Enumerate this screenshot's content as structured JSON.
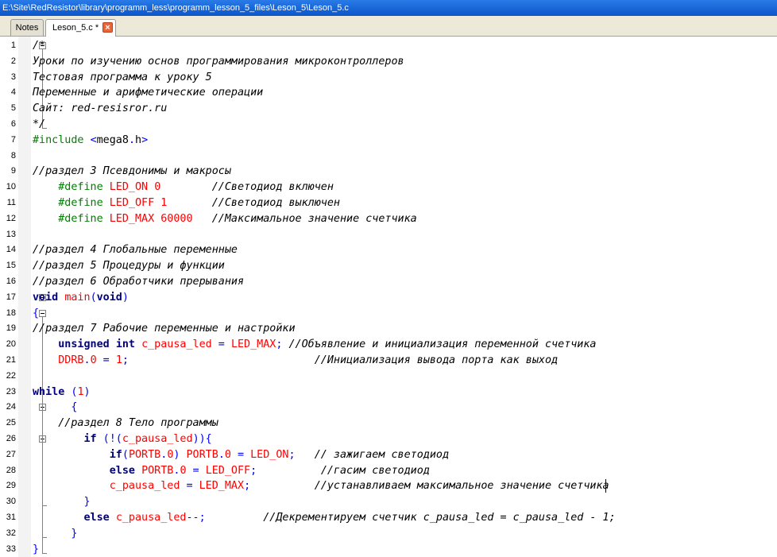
{
  "window": {
    "title": "E:\\Site\\RedResistor\\library\\programm_less\\programm_lesson_5_files\\Leson_5\\Leson_5.c"
  },
  "tabs": [
    {
      "label": "Notes",
      "active": false
    },
    {
      "label": "Leson_5.c *",
      "active": true,
      "close_icon": "close-icon"
    }
  ],
  "colors": {
    "comment": "#000000",
    "keyword": "#000080",
    "preprocessor": "#008000",
    "operator": "#0000ff",
    "identifier": "#000000",
    "red": "#ff0000",
    "title_bar": "#0b55c8"
  },
  "editor": {
    "line_numbers": [
      "1",
      "2",
      "3",
      "4",
      "5",
      "6",
      "7",
      "8",
      "9",
      "10",
      "11",
      "12",
      "13",
      "14",
      "15",
      "16",
      "17",
      "18",
      "19",
      "20",
      "21",
      "22",
      "23",
      "24",
      "25",
      "26",
      "27",
      "28",
      "29",
      "30",
      "31",
      "32",
      "33"
    ],
    "lines": [
      [
        {
          "t": "/*",
          "c": "comment",
          "s": "it"
        }
      ],
      [
        {
          "t": "Уроки по изучению основ программирования микроконтроллеров",
          "c": "comment",
          "s": "it"
        }
      ],
      [
        {
          "t": "Тестовая программа к уроку 5",
          "c": "comment",
          "s": "it"
        }
      ],
      [
        {
          "t": "Переменные и арифметические операции",
          "c": "comment",
          "s": "it"
        }
      ],
      [
        {
          "t": "Сайт: red-resisror.ru",
          "c": "comment",
          "s": "it"
        }
      ],
      [
        {
          "t": "*/",
          "c": "comment",
          "s": "it"
        }
      ],
      [
        {
          "t": "#include ",
          "c": "preprocessor"
        },
        {
          "t": "<",
          "c": "operator"
        },
        {
          "t": "mega8",
          "c": "identifier"
        },
        {
          "t": ".",
          "c": "operator"
        },
        {
          "t": "h",
          "c": "identifier"
        },
        {
          "t": ">",
          "c": "operator"
        }
      ],
      [],
      [
        {
          "t": "//раздел 3 Псевдонимы и макросы",
          "c": "comment",
          "s": "it"
        }
      ],
      [
        {
          "t": "    #define ",
          "c": "preprocessor"
        },
        {
          "t": "LED_ON 0        ",
          "c": "preprocessor_val"
        },
        {
          "t": "//Светодиод включен",
          "c": "comment",
          "s": "it"
        }
      ],
      [
        {
          "t": "    #define ",
          "c": "preprocessor"
        },
        {
          "t": "LED_OFF 1       ",
          "c": "preprocessor_val"
        },
        {
          "t": "//Светодиод выключен",
          "c": "comment",
          "s": "it"
        }
      ],
      [
        {
          "t": "    #define ",
          "c": "preprocessor"
        },
        {
          "t": "LED_MAX 60000   ",
          "c": "preprocessor_val"
        },
        {
          "t": "//Максимальное значение счетчика",
          "c": "comment",
          "s": "it"
        }
      ],
      [],
      [
        {
          "t": "//раздел 4 Глобальные переменные",
          "c": "comment",
          "s": "it"
        }
      ],
      [
        {
          "t": "//раздел 5 Процедуры и функции",
          "c": "comment",
          "s": "it"
        }
      ],
      [
        {
          "t": "//раздел 6 Обработчики прерывания",
          "c": "comment",
          "s": "it"
        }
      ],
      [
        {
          "t": "void",
          "c": "keyword",
          "s": "bd"
        },
        {
          "t": " ",
          "c": "identifier"
        },
        {
          "t": "main",
          "c": "red"
        },
        {
          "t": "(",
          "c": "operator"
        },
        {
          "t": "void",
          "c": "keyword",
          "s": "bd"
        },
        {
          "t": ")",
          "c": "operator"
        }
      ],
      [
        {
          "t": "{",
          "c": "operator"
        }
      ],
      [
        {
          "t": "//раздел 7 Рабочие переменные и настройки",
          "c": "comment",
          "s": "it"
        }
      ],
      [
        {
          "t": "    ",
          "c": "identifier"
        },
        {
          "t": "unsigned",
          "c": "keyword",
          "s": "bd"
        },
        {
          "t": " ",
          "c": "identifier"
        },
        {
          "t": "int",
          "c": "keyword",
          "s": "bd"
        },
        {
          "t": " ",
          "c": "identifier"
        },
        {
          "t": "c_pausa_led",
          "c": "red"
        },
        {
          "t": " = ",
          "c": "operator"
        },
        {
          "t": "LED_MAX",
          "c": "red"
        },
        {
          "t": "; ",
          "c": "operator"
        },
        {
          "t": "//Объявление и инициализация переменной счетчика",
          "c": "comment",
          "s": "it"
        }
      ],
      [
        {
          "t": "    ",
          "c": "identifier"
        },
        {
          "t": "DDRB",
          "c": "red"
        },
        {
          "t": ".",
          "c": "operator"
        },
        {
          "t": "0",
          "c": "red"
        },
        {
          "t": " = ",
          "c": "operator"
        },
        {
          "t": "1",
          "c": "red"
        },
        {
          "t": ";                             ",
          "c": "operator"
        },
        {
          "t": "//Инициализация вывода порта как выход",
          "c": "comment",
          "s": "it"
        }
      ],
      [],
      [
        {
          "t": "while",
          "c": "keyword",
          "s": "bd"
        },
        {
          "t": " ",
          "c": "identifier"
        },
        {
          "t": "(",
          "c": "operator"
        },
        {
          "t": "1",
          "c": "red"
        },
        {
          "t": ")",
          "c": "operator"
        }
      ],
      [
        {
          "t": "      {",
          "c": "operator"
        }
      ],
      [
        {
          "t": "    ",
          "c": "identifier"
        },
        {
          "t": "//раздел 8 Тело программы",
          "c": "comment",
          "s": "it"
        }
      ],
      [
        {
          "t": "        ",
          "c": "identifier"
        },
        {
          "t": "if",
          "c": "keyword",
          "s": "bd"
        },
        {
          "t": " (!(",
          "c": "operator"
        },
        {
          "t": "c_pausa_led",
          "c": "red"
        },
        {
          "t": ")){",
          "c": "operator"
        }
      ],
      [
        {
          "t": "            ",
          "c": "identifier"
        },
        {
          "t": "if",
          "c": "keyword",
          "s": "bd"
        },
        {
          "t": "(",
          "c": "operator"
        },
        {
          "t": "PORTB",
          "c": "red"
        },
        {
          "t": ".",
          "c": "operator"
        },
        {
          "t": "0",
          "c": "red"
        },
        {
          "t": ") ",
          "c": "operator"
        },
        {
          "t": "PORTB",
          "c": "red"
        },
        {
          "t": ".",
          "c": "operator"
        },
        {
          "t": "0",
          "c": "red"
        },
        {
          "t": " = ",
          "c": "operator"
        },
        {
          "t": "LED_ON",
          "c": "red"
        },
        {
          "t": ";   ",
          "c": "operator"
        },
        {
          "t": "// зажигаем светодиод",
          "c": "comment",
          "s": "it"
        }
      ],
      [
        {
          "t": "            ",
          "c": "identifier"
        },
        {
          "t": "else",
          "c": "keyword",
          "s": "bd"
        },
        {
          "t": " ",
          "c": "identifier"
        },
        {
          "t": "PORTB",
          "c": "red"
        },
        {
          "t": ".",
          "c": "operator"
        },
        {
          "t": "0",
          "c": "red"
        },
        {
          "t": " = ",
          "c": "operator"
        },
        {
          "t": "LED_OFF",
          "c": "red"
        },
        {
          "t": ";          ",
          "c": "operator"
        },
        {
          "t": "//гасим светодиод",
          "c": "comment",
          "s": "it"
        }
      ],
      [
        {
          "t": "            ",
          "c": "identifier"
        },
        {
          "t": "c_pausa_led",
          "c": "red"
        },
        {
          "t": " = ",
          "c": "operator"
        },
        {
          "t": "LED_MAX",
          "c": "red"
        },
        {
          "t": ";          ",
          "c": "operator"
        },
        {
          "t": "//устанавливаем максимальное значение счетчика",
          "c": "comment",
          "s": "it"
        }
      ],
      [
        {
          "t": "        }",
          "c": "operator"
        }
      ],
      [
        {
          "t": "        ",
          "c": "identifier"
        },
        {
          "t": "else",
          "c": "keyword",
          "s": "bd"
        },
        {
          "t": " ",
          "c": "identifier"
        },
        {
          "t": "c_pausa_led",
          "c": "red"
        },
        {
          "t": "--;         ",
          "c": "operator"
        },
        {
          "t": "//Декрементируем счетчик c_pausa_led = c_pausa_led - 1;",
          "c": "comment",
          "s": "it"
        }
      ],
      [
        {
          "t": "      }",
          "c": "operator"
        }
      ],
      [
        {
          "t": "}",
          "c": "operator"
        }
      ]
    ]
  }
}
